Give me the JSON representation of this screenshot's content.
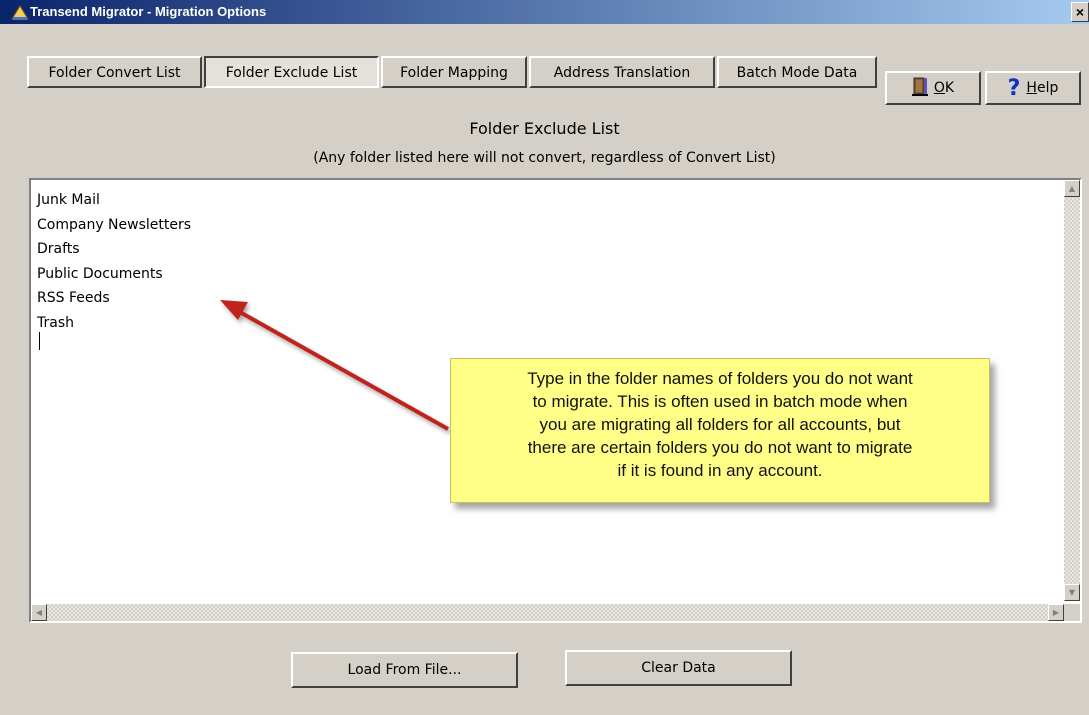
{
  "window": {
    "title": "Transend Migrator - Migration Options",
    "close_label": "×"
  },
  "tabs": [
    {
      "label": "Folder Convert List",
      "active": false
    },
    {
      "label": "Folder Exclude List",
      "active": true
    },
    {
      "label": "Folder Mapping",
      "active": false
    },
    {
      "label": "Address Translation",
      "active": false
    },
    {
      "label": "Batch Mode Data",
      "active": false
    }
  ],
  "ok_button": {
    "underlined": "O",
    "rest": "K",
    "icon": "door-icon"
  },
  "help_button": {
    "icon_glyph": "?",
    "underlined": "H",
    "rest": "elp",
    "icon": "question-icon"
  },
  "heading": "Folder Exclude List",
  "subheading": "(Any folder listed here will not convert, regardless of Convert List)",
  "exclude_list": [
    "Junk Mail",
    "Company Newsletters",
    "Drafts",
    "Public Documents",
    "RSS Feeds",
    "Trash"
  ],
  "callout": {
    "lines": [
      "Type in the folder names of folders you do not want",
      "to migrate. This is often used in batch mode when",
      "you are migrating all folders for all accounts, but",
      "there are certain folders you do not want to migrate",
      "if it is found in any account."
    ],
    "color": "#ffff88",
    "arrow_color": "#c0201c"
  },
  "footer": {
    "load_label": "Load From File...",
    "clear_label": "Clear Data"
  }
}
